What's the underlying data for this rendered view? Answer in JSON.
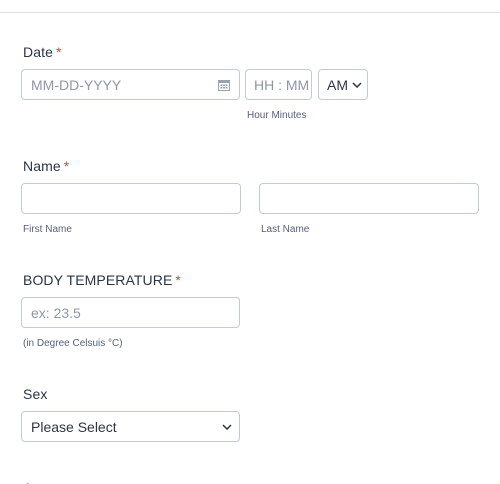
{
  "date": {
    "label": "Date",
    "required_mark": "*",
    "date_placeholder": "MM-DD-YYYY",
    "time_placeholder": "HH : MM",
    "ampm_value": "AM",
    "time_sublabel": "Hour Minutes",
    "calendar_icon": "calendar-icon"
  },
  "name": {
    "label": "Name",
    "required_mark": "*",
    "first_sublabel": "First Name",
    "last_sublabel": "Last Name"
  },
  "temperature": {
    "label": "BODY TEMPERATURE",
    "required_mark": "*",
    "placeholder": "ex: 23.5",
    "sublabel": "(in Degree Celsuis °C)"
  },
  "sex": {
    "label": "Sex",
    "selected": "Please Select"
  },
  "next_label_partial": "A",
  "colors": {
    "required": "#e3413b",
    "border": "#c3cad8",
    "text": "#2c3345",
    "placeholder": "#8e96a8"
  }
}
